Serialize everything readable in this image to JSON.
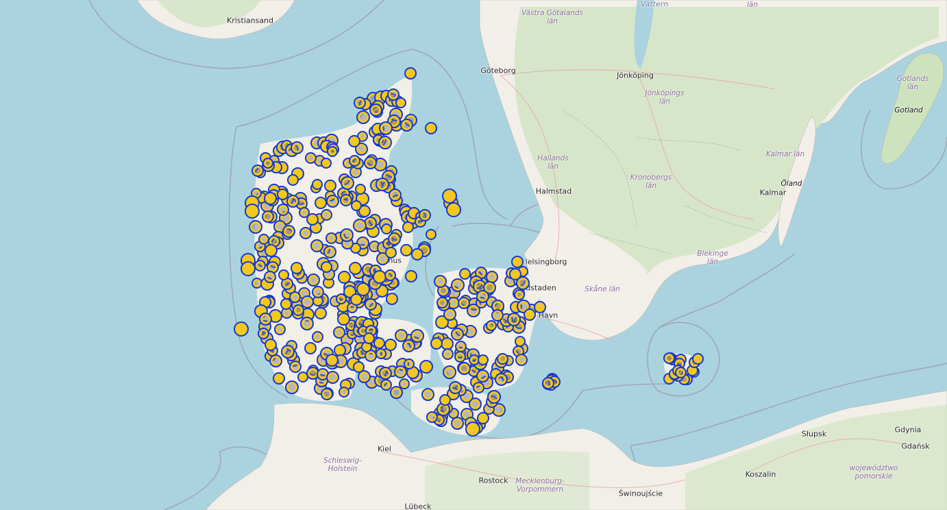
{
  "map": {
    "colors": {
      "water": "#aad3df",
      "land": "#f2efe9",
      "forest": "#cde3bd",
      "border": "#9e9cab",
      "marker_fill": "#f2c81c",
      "marker_stroke": "#1238d8",
      "marker_halo": "rgba(110,110,140,0.45)"
    },
    "places": {
      "kristiansand": "Kristiansand",
      "goteborg": "Göteborg",
      "jonkoping": "Jönköping",
      "halmstad": "Halmstad",
      "kalmar": "Kalmar",
      "helsingborg": "lelsingborg",
      "landskrona": "ndstaden",
      "havn": "Havn",
      "aarhus": "rhus",
      "kiel": "Kiel",
      "rostock": "Rostock",
      "swinoujscie": "Świnoujście",
      "koszalin": "Koszalin",
      "slupsk": "Słupsk",
      "gdynia": "Gdynia",
      "gdansk": "Gdańsk",
      "lubeck": "Lübeck",
      "vattern": "Vättern"
    },
    "regions": {
      "vastra_gotaland": [
        "Västra Götalands",
        "län"
      ],
      "jonkopings_lan": [
        "Jönköpings",
        "län"
      ],
      "hallands_lan": [
        "Hallands",
        "län"
      ],
      "kronobergs_lan": [
        "Kronobergs",
        "län"
      ],
      "kalmar_lan": [
        "Kalmar län"
      ],
      "blekinge_lan": [
        "Blekinge",
        "län"
      ],
      "skane_lan": [
        "Skåne län"
      ],
      "gotlands_lan": [
        "Gotlands",
        "län"
      ],
      "ostergotland_lan": [
        "län"
      ],
      "schleswig_holstein": [
        "Schleswig-",
        "Holstein"
      ],
      "mecklenburg": [
        "Mecklenburg-",
        "Vorpommern"
      ],
      "pomorskie": [
        "województwo",
        "pomorskie"
      ]
    },
    "islands": {
      "gotland": "Gotland",
      "oland": "Öland"
    },
    "markers": {
      "description_icon": "map-marker-circle",
      "count_shown": "dense cluster over Denmark"
    }
  }
}
